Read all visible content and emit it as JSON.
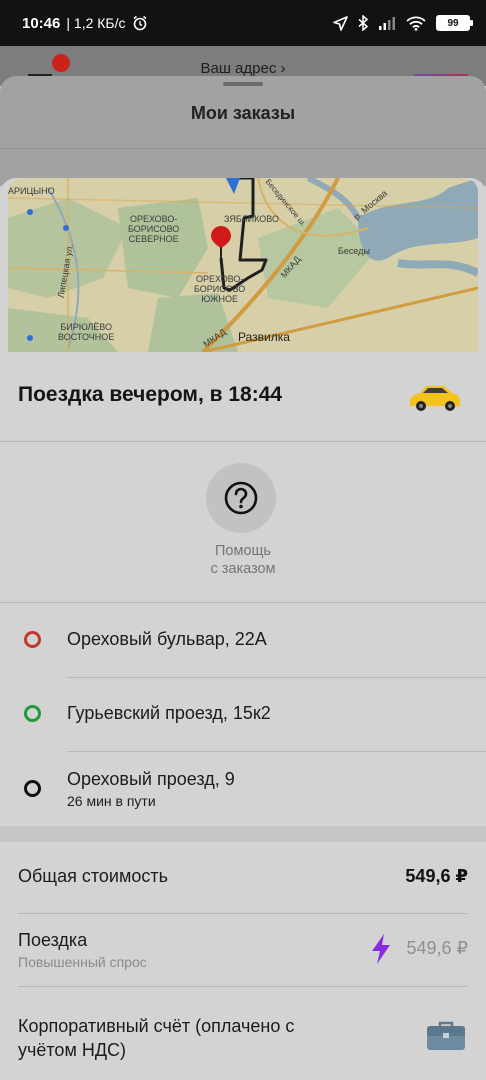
{
  "status_bar": {
    "time": "10:46",
    "network_speed": "| 1,2 КБ/с",
    "battery": "99",
    "icons": [
      "alarm-icon",
      "location-arrow-icon",
      "bluetooth-icon",
      "signal-icon",
      "wifi-icon",
      "battery-icon"
    ]
  },
  "background": {
    "address_label": "Ваш адрес ›",
    "sheet_title": "Мои заказы"
  },
  "map": {
    "labels": {
      "aritsyno": "АРИЦЫНО",
      "orekhovo_sev": "ОРЕХОВО-\nБОРИСОВО\nСЕВЕРНОЕ",
      "zyablikovo": "ЗЯБЛИКОВО",
      "besedinskoe": "Бесединское ш.",
      "r_moskva": "р. Москва",
      "besedy": "Беседы",
      "orekhovo_yuzh": "ОРЕХОВО-\nБОРИСОВО\nЮЖНОЕ",
      "mkad1": "МКАД",
      "mkad2": "МКАД",
      "lipetskaya": "Липецкая ул.",
      "biryulevo": "БИРЮЛЁВО\nВОСТОЧНОЕ",
      "razvilka": "Развилка"
    }
  },
  "trip": {
    "title": "Поездка вечером, в 18:44",
    "taxi_icon": "taxi-car-icon"
  },
  "help": {
    "icon": "question-icon",
    "label_line1": "Помощь",
    "label_line2": "с заказом"
  },
  "route": [
    {
      "address": "Ореховый бульвар, 22А",
      "color": "#c0392b"
    },
    {
      "address": "Гурьевский проезд, 15к2",
      "color": "#1f9a3a"
    },
    {
      "address": "Ореховый проезд, 9",
      "sub": "26 мин в пути",
      "color": "#111111"
    }
  ],
  "pricing": {
    "total_label": "Общая стоимость",
    "total_value": "549,6 ₽",
    "ride_label": "Поездка",
    "ride_sub": "Повышенный спрос",
    "ride_value": "549,6 ₽",
    "surge_color": "#8a2be2",
    "corporate_line1": "Корпоративный счёт (оплачено с",
    "corporate_line2": "учётом НДС)",
    "corporate_icon": "briefcase-icon"
  }
}
